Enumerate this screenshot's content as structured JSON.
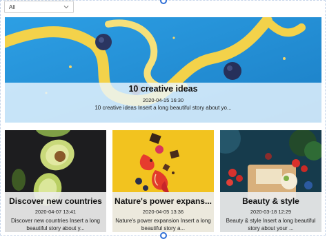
{
  "filter": {
    "selected": "All"
  },
  "hero": {
    "title": "10 creative ideas",
    "date": "2020-04-15 16:30",
    "description": "10 creative ideas   Insert a long beautiful story about yo..."
  },
  "cards": [
    {
      "title": "Discover new countries",
      "date": "2020-04-07 13:41",
      "description": "Discover new countries   Insert a long beautiful story about y..."
    },
    {
      "title": "Nature's power expans...",
      "date": "2020-04-05 13:36",
      "description": "Nature's power expansion   Insert a long beautiful story a..."
    },
    {
      "title": "Beauty & style",
      "date": "2020-03-18 12:29",
      "description": "Beauty & style   Insert a long beautiful story about your ..."
    }
  ],
  "icons": {
    "dropdown": "chevron-down-icon"
  }
}
